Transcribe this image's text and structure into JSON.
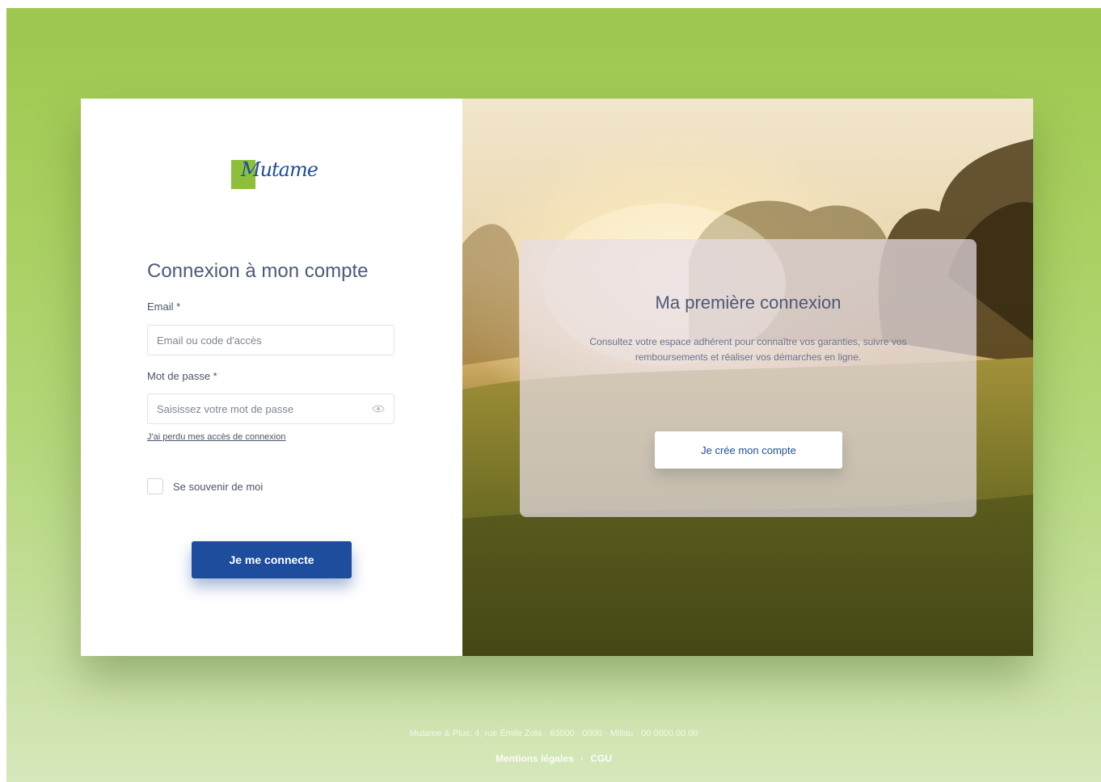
{
  "brand": {
    "logo_text": "Mutame",
    "tagline": "",
    "top_small": ""
  },
  "login": {
    "title": "Connexion à mon compte",
    "email_label": "Email *",
    "email_placeholder": "Email ou code d'accès",
    "password_label": "Mot de passe *",
    "password_placeholder": "Saisissez votre mot de passe",
    "forgot_link": "J'ai perdu mes accès de connexion",
    "remember_label": "Se souvenir de moi",
    "submit_label": "Je me connecte"
  },
  "first_login": {
    "title": "Ma première connexion",
    "description": "Consultez votre espace adhérent pour connaître vos garanties, suivre vos remboursements et réaliser vos démarches en ligne.",
    "button_label": "Je crée mon compte"
  },
  "footer": {
    "address": "Mutame & Plus, 4, rue Émile Zola · 63000 · 0000 · Millau · 00 0000 00 00",
    "legal_link": "Mentions légales",
    "separator": "·",
    "cgu_link": "CGU"
  },
  "colors": {
    "primary": "#1e4d9e",
    "accent_green": "#8dbf3a",
    "title_text": "#4d5a78"
  }
}
